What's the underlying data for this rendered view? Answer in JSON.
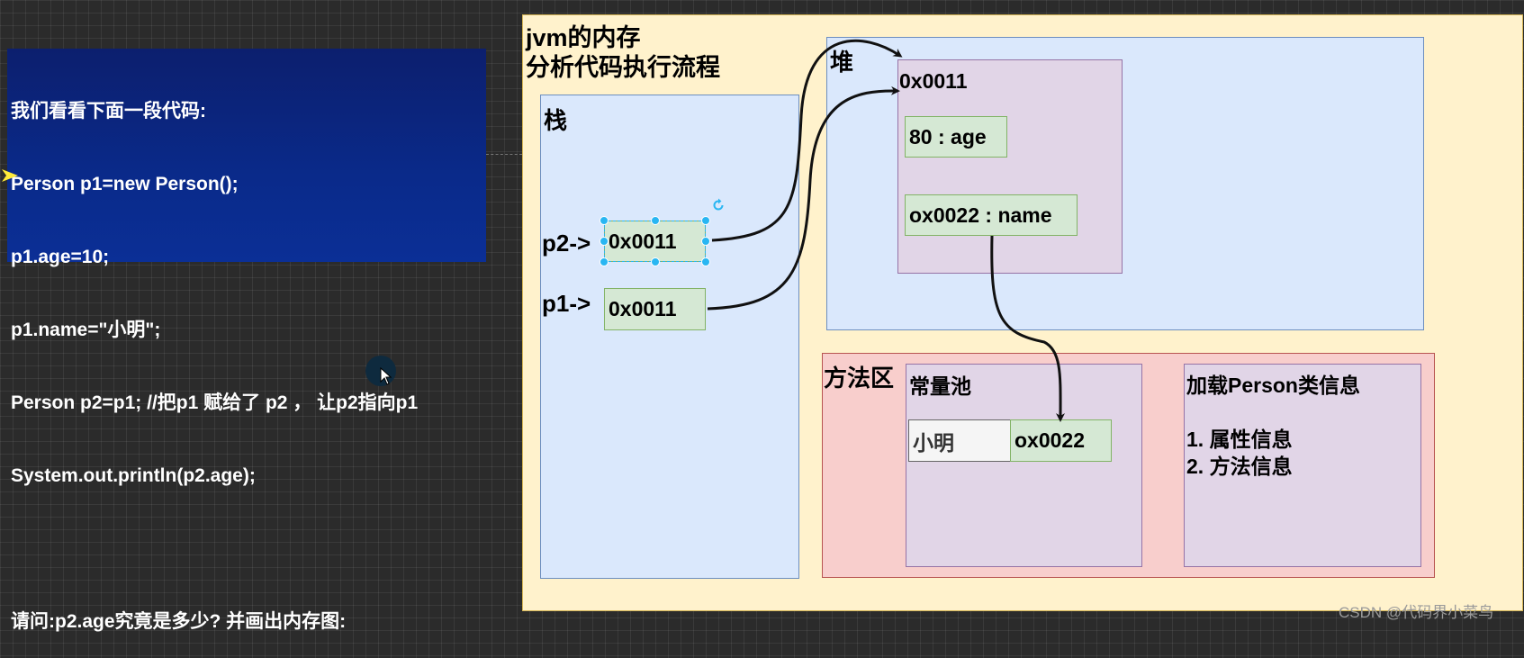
{
  "code": {
    "lines": [
      "我们看看下面一段代码:",
      "Person p1=new Person();",
      "p1.age=10;",
      "p1.name=\"小明\";",
      "Person p2=p1; //把p1 赋给了 p2 ， 让p2指向p1",
      "System.out.println(p2.age);",
      "",
      "请问:p2.age究竟是多少? 并画出内存图:"
    ]
  },
  "diagram": {
    "title_line1": "jvm的内存",
    "title_line2": "分析代码执行流程",
    "stack": {
      "label": "栈",
      "p2_label": "p2->",
      "p2_value": "0x0011",
      "p1_label": "p1->",
      "p1_value": "0x0011"
    },
    "heap": {
      "label": "堆",
      "object_address": "0x0011",
      "age_field": "80 : age",
      "name_field": "ox0022 : name"
    },
    "method_area": {
      "label": "方法区",
      "constant_pool": {
        "label": "常量池",
        "string_value": "小明",
        "string_address": "ox0022"
      },
      "class_info": {
        "label": "加载Person类信息",
        "item1": "1. 属性信息",
        "item2": "2. 方法信息"
      }
    }
  },
  "watermark": "CSDN @代码界小菜鸟",
  "colors": {
    "canvas": "#2b2b2b",
    "code_panel": "#0c2a8a",
    "diagram_bg": "#fff2cc",
    "stack_heap": "#dae8fc",
    "object_purple": "#e1d5e7",
    "method_area_red": "#f8cecc",
    "value_green": "#d5e8d4",
    "selection_blue": "#29b6f2"
  }
}
